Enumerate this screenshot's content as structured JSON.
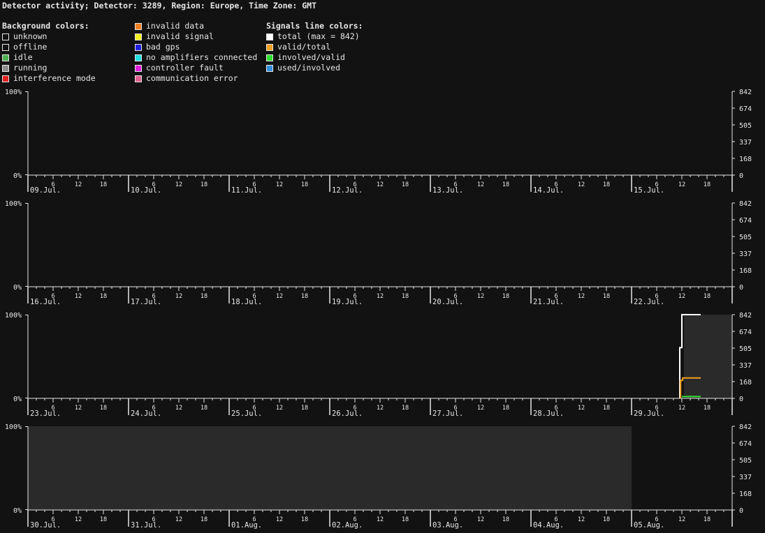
{
  "title": "Detector activity; Detector: 3289, Region: Europe, Time Zone: GMT",
  "legend": {
    "background_heading": "Background colors:",
    "signals_heading": "Signals line colors:",
    "background_col1": [
      {
        "label": "unknown",
        "color": "#121212"
      },
      {
        "label": "offline",
        "color": "#121212"
      },
      {
        "label": "idle",
        "color": "#4caf50"
      },
      {
        "label": "running",
        "color": "#8c8c8c"
      },
      {
        "label": "interference mode",
        "color": "#e02020"
      }
    ],
    "background_col2": [
      {
        "label": "invalid data",
        "color": "#f08020"
      },
      {
        "label": "invalid signal",
        "color": "#f0f020"
      },
      {
        "label": "bad gps",
        "color": "#2020e0"
      },
      {
        "label": "no amplifiers connected",
        "color": "#20e0e0"
      },
      {
        "label": "controller fault",
        "color": "#e020e0"
      },
      {
        "label": "communication error",
        "color": "#e06090"
      }
    ],
    "signals": [
      {
        "label": "total (max = 842)",
        "color": "#ffffff"
      },
      {
        "label": "valid/total",
        "color": "#f0a020"
      },
      {
        "label": "involved/valid",
        "color": "#30e030"
      },
      {
        "label": "used/involved",
        "color": "#3090e0"
      }
    ]
  },
  "chart_data": [
    {
      "type": "line",
      "days": [
        "09.Jul.",
        "10.Jul.",
        "11.Jul.",
        "12.Jul.",
        "13.Jul.",
        "14.Jul.",
        "15.Jul."
      ],
      "hour_ticks": [
        "6",
        "12",
        "18"
      ],
      "left_axis": [
        "100%",
        "0%"
      ],
      "right_axis": [
        "842",
        "674",
        "505",
        "337",
        "168",
        "0"
      ],
      "ylim_signals": [
        0,
        842
      ],
      "background_spans": [],
      "series": []
    },
    {
      "type": "line",
      "days": [
        "16.Jul.",
        "17.Jul.",
        "18.Jul.",
        "19.Jul.",
        "20.Jul.",
        "21.Jul.",
        "22.Jul."
      ],
      "hour_ticks": [
        "6",
        "12",
        "18"
      ],
      "left_axis": [
        "100%",
        "0%"
      ],
      "right_axis": [
        "842",
        "674",
        "505",
        "337",
        "168",
        "0"
      ],
      "ylim_signals": [
        0,
        842
      ],
      "background_spans": [],
      "series": []
    },
    {
      "type": "line",
      "days": [
        "23.Jul.",
        "24.Jul.",
        "25.Jul.",
        "26.Jul.",
        "27.Jul.",
        "28.Jul.",
        "29.Jul."
      ],
      "hour_ticks": [
        "6",
        "12",
        "18"
      ],
      "left_axis": [
        "100%",
        "0%"
      ],
      "right_axis": [
        "842",
        "674",
        "505",
        "337",
        "168",
        "0"
      ],
      "ylim_signals": [
        0,
        842
      ],
      "background_spans": [
        {
          "state": "running",
          "start_hours": 156.5,
          "end_hours": 168
        }
      ],
      "series": [
        {
          "name": "total",
          "color": "#ffffff",
          "points": [
            [
              155.5,
              0
            ],
            [
              155.5,
              510
            ],
            [
              156,
              510
            ],
            [
              156,
              842
            ],
            [
              160.5,
              842
            ]
          ]
        },
        {
          "name": "valid/total",
          "color": "#f0a020",
          "points": [
            [
              155.7,
              0
            ],
            [
              155.7,
              180
            ],
            [
              156.2,
              180
            ],
            [
              156.2,
              205
            ],
            [
              160.5,
              205
            ]
          ]
        },
        {
          "name": "involved/valid",
          "color": "#30e030",
          "points": [
            [
              156,
              18
            ],
            [
              160.5,
              18
            ]
          ]
        }
      ]
    },
    {
      "type": "line",
      "days": [
        "30.Jul.",
        "31.Jul.",
        "01.Aug.",
        "02.Aug.",
        "03.Aug.",
        "04.Aug.",
        "05.Aug."
      ],
      "hour_ticks": [
        "6",
        "12",
        "18"
      ],
      "left_axis": [
        "100%",
        "0%"
      ],
      "right_axis": [
        "842",
        "674",
        "505",
        "337",
        "168",
        "0"
      ],
      "ylim_signals": [
        0,
        842
      ],
      "background_spans": [
        {
          "state": "running",
          "start_hours": 0,
          "end_hours": 144
        }
      ],
      "series": []
    }
  ]
}
